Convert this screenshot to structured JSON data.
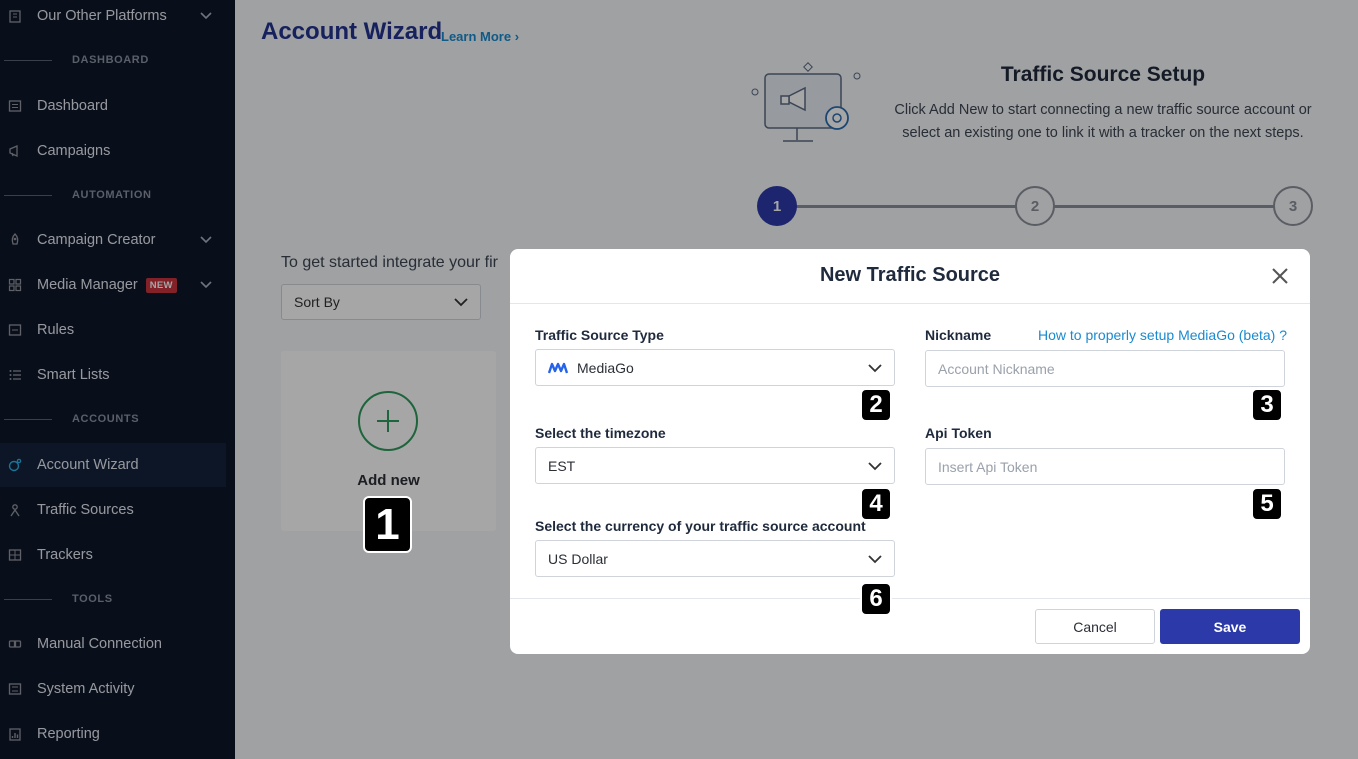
{
  "sidebar": {
    "top_item": "Our Other Platforms",
    "sections": {
      "dashboard": "DASHBOARD",
      "automation": "AUTOMATION",
      "accounts": "ACCOUNTS",
      "tools": "TOOLS"
    },
    "items": {
      "dashboard": "Dashboard",
      "campaigns": "Campaigns",
      "campaign_creator": "Campaign Creator",
      "media_manager": "Media Manager",
      "media_manager_badge": "NEW",
      "rules": "Rules",
      "smart_lists": "Smart Lists",
      "account_wizard": "Account Wizard",
      "traffic_sources": "Traffic Sources",
      "trackers": "Trackers",
      "manual_connection": "Manual Connection",
      "system_activity": "System Activity",
      "reporting": "Reporting"
    },
    "active_item": "Account Wizard"
  },
  "main": {
    "title": "Account Wizard",
    "learn_more": "Learn More",
    "setup_title": "Traffic Source Setup",
    "setup_desc": "Click Add New to start connecting a new traffic source account or select an existing one to link it with a tracker on the next steps.",
    "steps": [
      "1",
      "2",
      "3"
    ],
    "active_step": 1,
    "intro_text": "To get started integrate your fir",
    "sort_by": "Sort By",
    "add_new": "Add new"
  },
  "modal": {
    "title": "New Traffic Source",
    "traffic_source_type_label": "Traffic Source Type",
    "traffic_source_type_value": "MediaGo",
    "nickname_label": "Nickname",
    "help_link": "How to properly setup MediaGo (beta) ?",
    "nickname_placeholder": "Account Nickname",
    "timezone_label": "Select the timezone",
    "timezone_value": "EST",
    "api_token_label": "Api Token",
    "api_token_placeholder": "Insert Api Token",
    "currency_label": "Select the currency of your traffic source account",
    "currency_value": "US Dollar",
    "cancel": "Cancel",
    "save": "Save"
  },
  "markers": [
    "1",
    "2",
    "3",
    "4",
    "5",
    "6"
  ],
  "colors": {
    "sidebar_bg": "#0f1729",
    "brand_blue": "#2b3aa8",
    "title_blue": "#22338f",
    "link_blue": "#1a8ad0",
    "add_green": "#2f9a5c",
    "badge_red": "#c8343d"
  }
}
